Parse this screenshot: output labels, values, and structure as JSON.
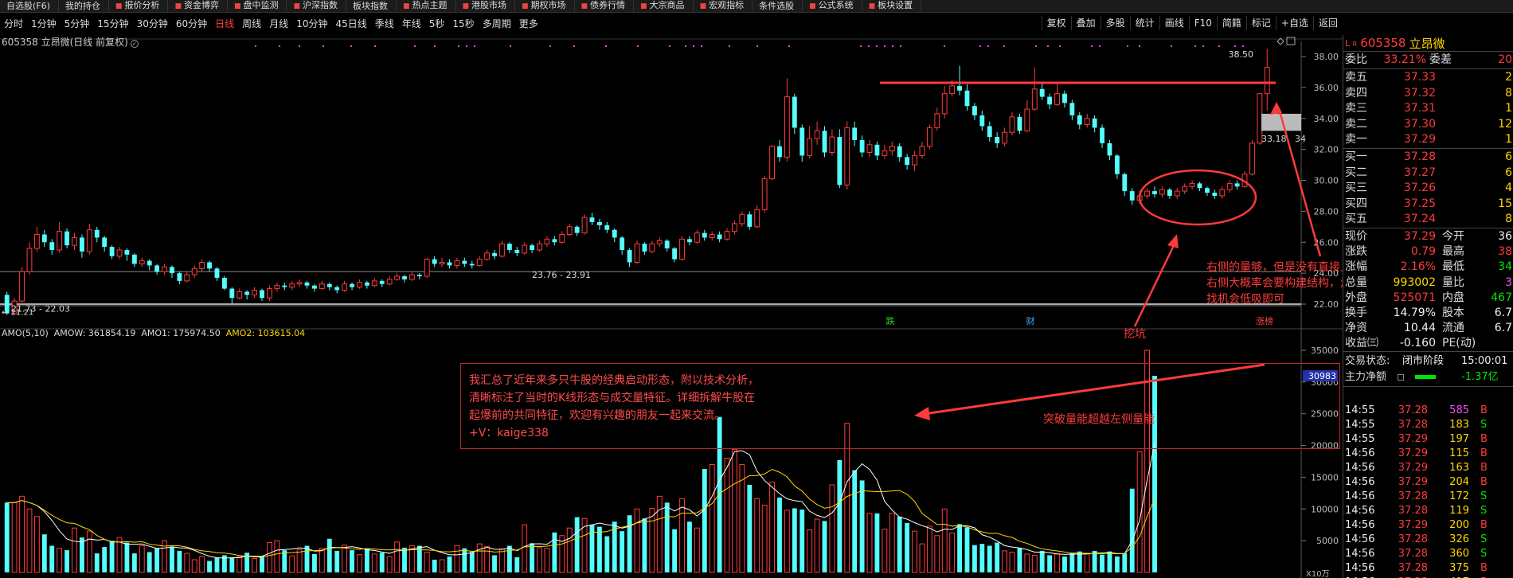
{
  "menu": [
    {
      "icon": "",
      "label": "自选股(F6)"
    },
    {
      "icon": "",
      "label": "我的持仓"
    },
    {
      "icon": "■",
      "label": "报价分析"
    },
    {
      "icon": "■",
      "label": "资金博弈"
    },
    {
      "icon": "■",
      "label": "盘中监测"
    },
    {
      "icon": "■",
      "label": "沪深指数"
    },
    {
      "icon": "",
      "label": "板块指数"
    },
    {
      "icon": "■",
      "label": "热点主题"
    },
    {
      "icon": "■",
      "label": "港股市场"
    },
    {
      "icon": "■",
      "label": "期权市场"
    },
    {
      "icon": "■",
      "label": "债券行情"
    },
    {
      "icon": "■",
      "label": "大宗商品"
    },
    {
      "icon": "■",
      "label": "宏观指标"
    },
    {
      "icon": "",
      "label": "条件选股"
    },
    {
      "icon": "■",
      "label": "公式系统"
    },
    {
      "icon": "■",
      "label": "板块设置"
    }
  ],
  "periods": [
    "分时",
    "1分钟",
    "5分钟",
    "15分钟",
    "30分钟",
    "60分钟",
    "日线",
    "周线",
    "月线",
    "10分钟",
    "45日线",
    "季线",
    "年线",
    "5秒",
    "15秒",
    "多周期",
    "更多"
  ],
  "selected_period": "日线",
  "tools": [
    "复权",
    "叠加",
    "多股",
    "统计",
    "画线",
    "F10",
    "简籍",
    "标记",
    "+自选",
    "返回"
  ],
  "stock_header": "605358 立昂微(日线 前复权)",
  "stock_header_icon": "✓",
  "price_axis": [
    "38.00",
    "36.00",
    "34.00",
    "32.00",
    "30.00",
    "28.00",
    "26.00",
    "24.00",
    "22.00"
  ],
  "price_labels": {
    "high": "38.50",
    "current_box": "33.18",
    "current_box_tail": "34",
    "range_mid": "23.76 - 23.91",
    "range_low": "21.73 - 22.03",
    "range_low_prefix": "← 21.21"
  },
  "event_markers": [
    {
      "label": "跌",
      "color": "#22dd22"
    },
    {
      "label": "财",
      "color": "#4aa8ff"
    },
    {
      "label": "涨榜",
      "color": "#ff4444"
    }
  ],
  "vol_header": {
    "name": "AMO(5,10)",
    "amow": "AMOW: 361854.19",
    "amo1": "AMO1: 175974.50",
    "amo2": "AMO2: 103615.04"
  },
  "vol_axis": [
    "35000",
    "30000",
    "25000",
    "20000",
    "15000",
    "10000",
    "5000"
  ],
  "vol_current_box": "30983",
  "vol_unit": "X10万",
  "info_box": {
    "lines": [
      "我汇总了近年来多只牛股的经典启动形态，附以技术分析，",
      "清晰标注了当时的K线形态与成交量特征。详细拆解牛股在",
      "起爆前的共同特征，欢迎有兴趣的朋友一起来交流。"
    ],
    "contact": "+V：kaige338"
  },
  "annotations": {
    "right_note": [
      "右侧的量够，但是没有直接上去，那么",
      "右侧大概率会要构建结构，走个震荡",
      "找机会低吸即可"
    ],
    "pit": "挖坑",
    "breakout": "突破量能超越左侧量能"
  },
  "quote": {
    "code": "605358",
    "name": "立昂微",
    "lr_prefix": "L",
    "lr_sub": "R",
    "weibi": {
      "label": "委比",
      "value": "33.21%",
      "cmp_label": "委差",
      "cmp_value": "20"
    },
    "asks": [
      {
        "label": "卖五",
        "price": "37.33",
        "vol": "2"
      },
      {
        "label": "卖四",
        "price": "37.32",
        "vol": "8"
      },
      {
        "label": "卖三",
        "price": "37.31",
        "vol": "1"
      },
      {
        "label": "卖二",
        "price": "37.30",
        "vol": "12"
      },
      {
        "label": "卖一",
        "price": "37.29",
        "vol": "1"
      }
    ],
    "bids": [
      {
        "label": "买一",
        "price": "37.28",
        "vol": "6"
      },
      {
        "label": "买二",
        "price": "37.27",
        "vol": "6"
      },
      {
        "label": "买三",
        "price": "37.26",
        "vol": "4"
      },
      {
        "label": "买四",
        "price": "37.25",
        "vol": "15"
      },
      {
        "label": "买五",
        "price": "37.24",
        "vol": "8"
      }
    ],
    "stats": [
      {
        "l1": "现价",
        "v1": "37.29",
        "c1": "red",
        "l2": "今开",
        "v2": "36",
        "c2": "white"
      },
      {
        "l1": "涨跌",
        "v1": "0.79",
        "c1": "red",
        "l2": "最高",
        "v2": "38",
        "c2": "red"
      },
      {
        "l1": "涨幅",
        "v1": "2.16%",
        "c1": "red",
        "l2": "最低",
        "v2": "34",
        "c2": "green"
      },
      {
        "l1": "总量",
        "v1": "993002",
        "c1": "yellow",
        "l2": "量比",
        "v2": "3",
        "c2": "magenta"
      },
      {
        "l1": "外盘",
        "v1": "525071",
        "c1": "red",
        "l2": "内盘",
        "v2": "467",
        "c2": "green"
      },
      {
        "l1": "换手",
        "v1": "14.79%",
        "c1": "white",
        "l2": "股本",
        "v2": "6.7",
        "c2": "white"
      },
      {
        "l1": "净资",
        "v1": "10.44",
        "c1": "white",
        "l2": "流通",
        "v2": "6.7",
        "c2": "white"
      },
      {
        "l1": "收益㈢",
        "v1": "-0.160",
        "c1": "white",
        "l2": "PE(动)",
        "v2": "",
        "c2": "white"
      }
    ],
    "trade_status_label": "交易状态:",
    "trade_status": "闭市阶段",
    "trade_time": "15:00:01",
    "main_flow_label": "主力净额",
    "main_flow_value": "-1.37亿",
    "ticks": [
      {
        "t": "14:55",
        "p": "37.28",
        "v": "585",
        "d": "B",
        "vc": "magenta"
      },
      {
        "t": "14:55",
        "p": "37.28",
        "v": "183",
        "d": "S",
        "vc": "yellow"
      },
      {
        "t": "14:55",
        "p": "37.29",
        "v": "197",
        "d": "B",
        "vc": "yellow"
      },
      {
        "t": "14:56",
        "p": "37.29",
        "v": "115",
        "d": "B",
        "vc": "yellow"
      },
      {
        "t": "14:56",
        "p": "37.29",
        "v": "163",
        "d": "B",
        "vc": "yellow"
      },
      {
        "t": "14:56",
        "p": "37.29",
        "v": "204",
        "d": "B",
        "vc": "yellow"
      },
      {
        "t": "14:56",
        "p": "37.28",
        "v": "172",
        "d": "S",
        "vc": "yellow"
      },
      {
        "t": "14:56",
        "p": "37.28",
        "v": "119",
        "d": "S",
        "vc": "yellow"
      },
      {
        "t": "14:56",
        "p": "37.29",
        "v": "200",
        "d": "B",
        "vc": "yellow"
      },
      {
        "t": "14:56",
        "p": "37.28",
        "v": "326",
        "d": "S",
        "vc": "yellow"
      },
      {
        "t": "14:56",
        "p": "37.28",
        "v": "360",
        "d": "S",
        "vc": "yellow"
      },
      {
        "t": "14:56",
        "p": "37.28",
        "v": "375",
        "d": "B",
        "vc": "yellow"
      },
      {
        "t": "14:56",
        "p": "37.28",
        "v": "417",
        "d": "B",
        "vc": "yellow"
      },
      {
        "t": "14:56",
        "p": "37.29",
        "v": "309",
        "d": "B",
        "vc": "yellow"
      }
    ]
  },
  "colors": {
    "up": "#ff3b3b",
    "down": "#54ffff",
    "ma_white": "#ffffff",
    "ma_yellow": "#ffd700",
    "annotation": "#ff3b3b"
  },
  "candles": [
    [
      22.6,
      21.4,
      22.8,
      21.3
    ],
    [
      21.4,
      22.2,
      22.4,
      21.3
    ],
    [
      22.2,
      24.1,
      24.4,
      22.1
    ],
    [
      24.1,
      25.6,
      26.0,
      23.9
    ],
    [
      25.6,
      26.5,
      27.0,
      25.4
    ],
    [
      26.5,
      26.0,
      26.8,
      25.7
    ],
    [
      26.0,
      25.5,
      26.2,
      25.2
    ],
    [
      25.5,
      26.7,
      27.3,
      25.3
    ],
    [
      26.7,
      25.8,
      26.9,
      25.6
    ],
    [
      25.8,
      26.3,
      26.6,
      25.5
    ],
    [
      26.3,
      25.4,
      26.5,
      25.0
    ],
    [
      25.4,
      26.8,
      27.2,
      25.2
    ],
    [
      26.8,
      26.3,
      27.0,
      26.0
    ],
    [
      26.3,
      25.7,
      26.4,
      25.4
    ],
    [
      25.7,
      25.1,
      25.8,
      24.9
    ],
    [
      25.1,
      25.5,
      25.7,
      24.9
    ],
    [
      25.5,
      25.2,
      25.6,
      24.8
    ],
    [
      25.2,
      24.6,
      25.3,
      24.4
    ],
    [
      24.6,
      24.8,
      25.0,
      24.4
    ],
    [
      24.8,
      24.5,
      24.9,
      24.2
    ],
    [
      24.5,
      24.1,
      24.6,
      23.9
    ],
    [
      24.1,
      24.4,
      24.6,
      23.9
    ],
    [
      24.4,
      24.0,
      24.5,
      23.7
    ],
    [
      24.0,
      23.5,
      24.1,
      23.3
    ],
    [
      23.5,
      23.9,
      24.1,
      23.4
    ],
    [
      23.9,
      24.3,
      24.5,
      23.7
    ],
    [
      24.3,
      24.7,
      24.9,
      24.1
    ],
    [
      24.7,
      24.3,
      24.8,
      24.1
    ],
    [
      24.3,
      23.7,
      24.4,
      23.5
    ],
    [
      23.7,
      23.0,
      23.8,
      22.9
    ],
    [
      23.0,
      22.4,
      23.1,
      22.0
    ],
    [
      22.4,
      22.8,
      23.0,
      22.3
    ],
    [
      22.8,
      22.6,
      22.9,
      22.3
    ],
    [
      22.6,
      22.9,
      23.1,
      22.4
    ],
    [
      22.9,
      22.4,
      23.0,
      22.2
    ],
    [
      22.4,
      23.0,
      23.2,
      22.2
    ],
    [
      23.0,
      23.2,
      23.4,
      22.8
    ],
    [
      23.2,
      23.1,
      23.4,
      22.9
    ],
    [
      23.1,
      23.3,
      23.5,
      22.9
    ],
    [
      23.3,
      23.4,
      23.6,
      23.1
    ],
    [
      23.4,
      23.2,
      23.5,
      23.0
    ],
    [
      23.2,
      23.0,
      23.3,
      22.8
    ],
    [
      23.0,
      23.3,
      23.5,
      22.9
    ],
    [
      23.3,
      23.1,
      23.4,
      22.9
    ],
    [
      23.1,
      22.9,
      23.2,
      22.7
    ],
    [
      22.9,
      23.3,
      23.5,
      22.8
    ],
    [
      23.3,
      23.1,
      23.4,
      22.9
    ],
    [
      23.1,
      23.4,
      23.6,
      23.0
    ],
    [
      23.4,
      23.2,
      23.5,
      23.0
    ],
    [
      23.2,
      23.5,
      23.7,
      23.1
    ],
    [
      23.5,
      23.3,
      23.6,
      23.1
    ],
    [
      23.3,
      23.6,
      23.8,
      23.2
    ],
    [
      23.6,
      23.8,
      24.0,
      23.5
    ],
    [
      23.8,
      23.6,
      23.9,
      23.4
    ],
    [
      23.6,
      23.9,
      24.1,
      23.5
    ],
    [
      23.9,
      23.8,
      24.0,
      23.6
    ],
    [
      23.8,
      24.9,
      25.0,
      23.7
    ],
    [
      24.9,
      24.6,
      25.1,
      24.4
    ],
    [
      24.6,
      24.7,
      25.0,
      24.4
    ],
    [
      24.7,
      24.5,
      24.9,
      24.3
    ],
    [
      24.5,
      24.8,
      25.0,
      24.3
    ],
    [
      24.8,
      24.6,
      25.0,
      24.4
    ],
    [
      24.6,
      24.5,
      24.8,
      24.3
    ],
    [
      24.5,
      24.9,
      25.1,
      24.4
    ],
    [
      24.9,
      25.3,
      25.5,
      24.8
    ],
    [
      25.3,
      25.1,
      25.5,
      24.9
    ],
    [
      25.1,
      25.9,
      26.1,
      25.0
    ],
    [
      25.9,
      25.5,
      26.0,
      25.3
    ],
    [
      25.5,
      25.3,
      25.7,
      25.1
    ],
    [
      25.3,
      25.8,
      26.0,
      25.2
    ],
    [
      25.8,
      25.5,
      25.9,
      25.3
    ],
    [
      25.5,
      25.9,
      26.1,
      25.4
    ],
    [
      25.9,
      26.2,
      26.4,
      25.7
    ],
    [
      26.2,
      26.0,
      26.4,
      25.8
    ],
    [
      26.0,
      26.5,
      26.7,
      25.9
    ],
    [
      26.5,
      27.0,
      27.2,
      26.4
    ],
    [
      27.0,
      26.6,
      27.1,
      26.4
    ],
    [
      26.6,
      27.6,
      27.8,
      26.5
    ],
    [
      27.6,
      27.3,
      27.9,
      27.1
    ],
    [
      27.3,
      27.1,
      27.5,
      26.8
    ],
    [
      27.1,
      26.8,
      27.3,
      26.6
    ],
    [
      26.8,
      26.3,
      26.9,
      26.0
    ],
    [
      26.3,
      25.5,
      26.4,
      25.2
    ],
    [
      25.5,
      24.7,
      25.6,
      24.4
    ],
    [
      24.7,
      25.9,
      26.1,
      24.6
    ],
    [
      25.9,
      25.4,
      26.0,
      25.2
    ],
    [
      25.4,
      25.9,
      26.1,
      25.3
    ],
    [
      25.9,
      26.1,
      26.3,
      25.7
    ],
    [
      26.1,
      25.6,
      26.2,
      25.4
    ],
    [
      25.6,
      24.9,
      25.7,
      24.7
    ],
    [
      24.9,
      26.2,
      26.4,
      24.8
    ],
    [
      26.2,
      26.0,
      26.4,
      25.8
    ],
    [
      26.0,
      26.6,
      26.8,
      25.9
    ],
    [
      26.6,
      26.3,
      26.8,
      26.1
    ],
    [
      26.3,
      26.5,
      26.7,
      26.1
    ],
    [
      26.5,
      26.2,
      26.7,
      26.0
    ],
    [
      26.2,
      26.7,
      26.9,
      26.1
    ],
    [
      26.7,
      27.2,
      27.4,
      26.5
    ],
    [
      27.2,
      27.8,
      28.0,
      27.0
    ],
    [
      27.8,
      27.0,
      28.0,
      26.8
    ],
    [
      27.0,
      28.1,
      28.4,
      26.9
    ],
    [
      28.1,
      30.1,
      30.3,
      27.9
    ],
    [
      30.1,
      32.2,
      32.3,
      30.0
    ],
    [
      32.2,
      31.5,
      32.6,
      31.2
    ],
    [
      31.5,
      35.4,
      36.6,
      31.2
    ],
    [
      35.4,
      33.4,
      35.6,
      33.0
    ],
    [
      33.4,
      31.6,
      33.6,
      31.2
    ],
    [
      31.6,
      32.7,
      33.5,
      31.4
    ],
    [
      32.7,
      33.2,
      33.8,
      32.3
    ],
    [
      33.2,
      31.8,
      33.5,
      31.5
    ],
    [
      31.8,
      32.8,
      33.3,
      31.6
    ],
    [
      32.8,
      29.7,
      33.3,
      29.5
    ],
    [
      29.7,
      33.4,
      33.8,
      29.4
    ],
    [
      33.4,
      32.6,
      33.8,
      32.2
    ],
    [
      32.6,
      31.8,
      32.9,
      31.5
    ],
    [
      31.8,
      32.3,
      32.6,
      31.5
    ],
    [
      32.3,
      31.6,
      32.5,
      31.3
    ],
    [
      31.6,
      31.9,
      32.3,
      31.4
    ],
    [
      31.9,
      32.2,
      32.5,
      31.6
    ],
    [
      32.2,
      31.5,
      32.4,
      31.2
    ],
    [
      31.5,
      31.0,
      31.7,
      30.7
    ],
    [
      31.0,
      31.6,
      31.9,
      30.6
    ],
    [
      31.6,
      32.2,
      32.5,
      31.4
    ],
    [
      32.2,
      33.4,
      33.6,
      32.0
    ],
    [
      33.4,
      34.3,
      34.7,
      33.2
    ],
    [
      34.3,
      35.6,
      36.1,
      34.0
    ],
    [
      35.6,
      36.1,
      36.5,
      35.4
    ],
    [
      36.1,
      35.8,
      37.4,
      35.5
    ],
    [
      35.8,
      34.8,
      36.2,
      34.5
    ],
    [
      34.8,
      34.2,
      35.0,
      33.9
    ],
    [
      34.2,
      33.5,
      34.5,
      33.2
    ],
    [
      33.5,
      32.8,
      33.8,
      32.5
    ],
    [
      32.8,
      32.4,
      33.1,
      32.1
    ],
    [
      32.4,
      33.1,
      33.4,
      32.2
    ],
    [
      33.1,
      34.1,
      34.4,
      32.9
    ],
    [
      34.1,
      33.2,
      34.3,
      33.0
    ],
    [
      33.2,
      34.6,
      35.2,
      33.1
    ],
    [
      34.6,
      35.9,
      37.3,
      34.5
    ],
    [
      35.9,
      35.4,
      36.3,
      35.2
    ],
    [
      35.4,
      34.9,
      35.6,
      34.6
    ],
    [
      34.9,
      35.6,
      36.3,
      34.8
    ],
    [
      35.6,
      35.0,
      35.8,
      34.7
    ],
    [
      35.0,
      34.2,
      35.2,
      33.9
    ],
    [
      34.2,
      33.6,
      34.4,
      33.3
    ],
    [
      33.6,
      34.0,
      34.3,
      33.4
    ],
    [
      34.0,
      33.4,
      34.2,
      33.1
    ],
    [
      33.4,
      32.4,
      33.6,
      32.1
    ],
    [
      32.4,
      31.6,
      32.6,
      31.3
    ],
    [
      31.6,
      30.4,
      31.7,
      30.1
    ],
    [
      30.4,
      29.3,
      30.5,
      29.0
    ],
    [
      29.3,
      28.7,
      29.5,
      28.4
    ],
    [
      28.7,
      29.0,
      29.3,
      28.5
    ],
    [
      29.0,
      29.3,
      29.5,
      28.8
    ],
    [
      29.3,
      29.1,
      29.6,
      28.9
    ],
    [
      29.1,
      29.4,
      29.6,
      28.9
    ],
    [
      29.4,
      29.0,
      29.5,
      28.8
    ],
    [
      29.0,
      29.3,
      29.5,
      28.8
    ],
    [
      29.3,
      29.6,
      29.8,
      29.1
    ],
    [
      29.6,
      29.8,
      30.0,
      29.4
    ],
    [
      29.8,
      29.5,
      29.9,
      29.3
    ],
    [
      29.5,
      29.2,
      29.6,
      29.0
    ],
    [
      29.2,
      29.0,
      29.4,
      28.8
    ],
    [
      29.0,
      29.4,
      29.6,
      28.8
    ],
    [
      29.4,
      29.8,
      30.0,
      29.2
    ],
    [
      29.8,
      29.6,
      30.0,
      29.4
    ],
    [
      29.6,
      30.4,
      30.6,
      29.5
    ],
    [
      30.4,
      32.4,
      32.6,
      30.3
    ],
    [
      32.4,
      35.6,
      35.6,
      32.3
    ],
    [
      35.6,
      37.3,
      38.5,
      34.5
    ]
  ],
  "volumes": [
    11000,
    11000,
    12000,
    10000,
    8800,
    6000,
    4200,
    3800,
    3500,
    7000,
    5500,
    6500,
    3000,
    4000,
    5000,
    5500,
    4700,
    3000,
    4200,
    3200,
    3800,
    5000,
    4000,
    3400,
    3000,
    2000,
    2500,
    1800,
    2300,
    2700,
    2300,
    2500,
    3100,
    2200,
    2600,
    4700,
    5000,
    3500,
    2600,
    3600,
    4200,
    2900,
    3800,
    5300,
    3400,
    4300,
    3500,
    2800,
    3800,
    2900,
    3100,
    2500,
    4800,
    3900,
    4200,
    4200,
    3200,
    2000,
    2000,
    2500,
    4200,
    3800,
    3200,
    4500,
    4100,
    2700,
    3700,
    4200,
    2400,
    7500,
    4600,
    3900,
    3800,
    6300,
    5800,
    7000,
    8700,
    8500,
    7500,
    7200,
    5700,
    8000,
    6500,
    9000,
    10000,
    8500,
    10100,
    12000,
    11000,
    6800,
    11600,
    8000,
    7000,
    16300,
    17000,
    24500,
    18000,
    19400,
    17000,
    13800,
    11600,
    10600,
    14200,
    11800,
    9800,
    10100,
    9900,
    6700,
    8400,
    8100,
    13800,
    17700,
    23500,
    16100,
    14500,
    9300,
    9300,
    6800,
    9300,
    8800,
    7800,
    6500,
    4500,
    7300,
    5800,
    10000,
    6200,
    7600,
    7100,
    4300,
    4500,
    4200,
    4700,
    3400,
    3200,
    3800,
    2900,
    2700,
    3400,
    2700,
    2900,
    2500,
    3000,
    3300,
    2900,
    3400,
    2800,
    3300,
    2500,
    3000,
    13200,
    19000,
    35000,
    30983
  ]
}
